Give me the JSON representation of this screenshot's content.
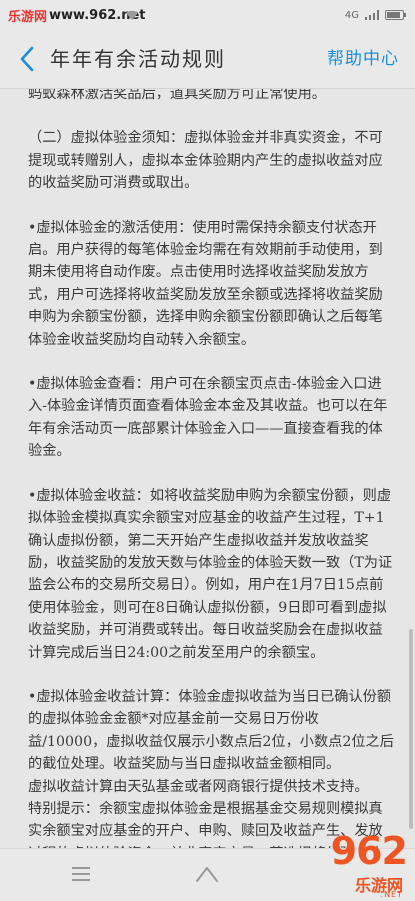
{
  "watermark_top": {
    "site": "乐游网",
    "url": "www.962.net"
  },
  "status": {
    "network": "4G"
  },
  "header": {
    "title": "年年有余活动规则",
    "help": "帮助中心"
  },
  "content": {
    "paragraphs": [
      "蚂蚁森林激活奖品后，道具奖励方可正常使用。",
      "（二）虚拟体验金须知：虚拟体验金并非真实资金，不可提现或转赠别人，虚拟本金体验期内产生的虚拟收益对应的收益奖励可消费或取出。",
      "•虚拟体验金的激活使用：使用时需保持余额支付状态开启。用户获得的每笔体验金均需在有效期前手动使用，到期未使用将自动作废。点击使用时选择收益奖励发放方式，用户可选择将收益奖励发放至余额或选择将收益奖励申购为余额宝份额，选择申购余额宝份额即确认之后每笔体验金收益奖励均自动转入余额宝。",
      "•虚拟体验金查看：用户可在余额宝页点击-体验金入口进入-体验金详情页面查看体验金本金及其收益。也可以在年年有余活动页一底部累计体验金入口——直接查看我的体验金。",
      "•虚拟体验金收益：如将收益奖励申购为余额宝份额，则虚拟体验金模拟真实余额宝对应基金的收益产生过程，T+1确认虚拟份额，第二天开始产生虚拟收益并发放收益奖励，收益奖励的发放天数与体验金的体验天数一致（T为证监会公布的交易所交易日）。例如，用户在1月7日15点前使用体验金，则可在8日确认虚拟份额，9日即可看到虚拟收益奖励，并可消费或转出。每日收益奖励会在虚拟收益计算完成后当日24:00之前发至用户的余额宝。",
      "•虚拟体验金收益计算：体验金虚拟收益为当日已确认份额的虚拟体验金金额*对应基金前一交易日万份收益/10000，虚拟收益仅展示小数点后2位，小数点2位之后的截位处理。收益奖励与当日虚拟收益金额相同。",
      "虚拟收益计算由天弘基金或者网商银行提供技术支持。",
      "特别提示：余额宝虚拟体验金是根据基金交易规则模拟真实余额宝对应基金的开户、申购、赎回及收益产生、发放过程的虚拟体验资金，并非真实交易。若选择将体验金收益奖励申购为余额宝份额或体验余额宝对应基金交易流程，新用户须完成风险测评、同意基金开户等相关协议并开立基金账户后方可进行。"
    ]
  },
  "watermark_bottom": {
    "mark": "962",
    "suffix": ".NET",
    "name": "乐游网"
  },
  "colors": {
    "accent": "#1a8fd8",
    "background": "#e6e6e6",
    "watermark": "#e52"
  }
}
